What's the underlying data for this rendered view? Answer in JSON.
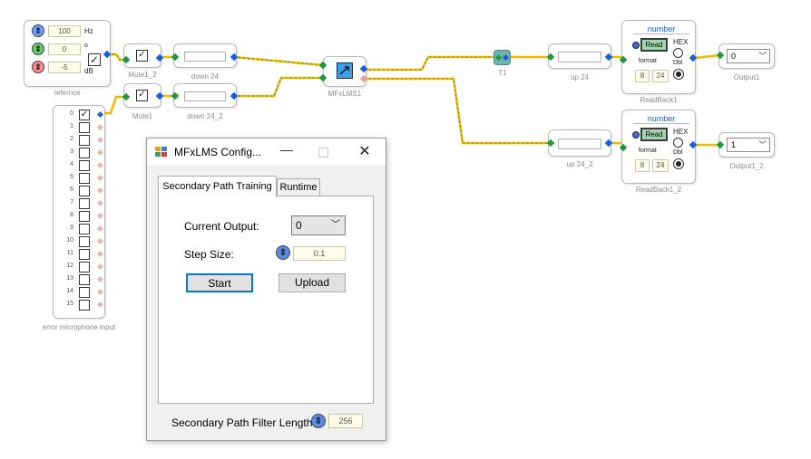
{
  "colors": {
    "wire": "#f5b800",
    "port_blue": "#1460e0",
    "port_green": "#1a9a3a",
    "accent": "#0a64c8"
  },
  "canvas": {
    "reference": {
      "caption": "refernce",
      "freq_value": "100",
      "freq_unit": "Hz",
      "phase_value": "0",
      "phase_unit": "o",
      "gain_value": "-5",
      "gain_unit": "dB"
    },
    "mute1_2": {
      "caption": "Mute1_2"
    },
    "mute1": {
      "caption": "Mute1"
    },
    "down24": {
      "caption": "down 24"
    },
    "down24_2": {
      "caption": "down 24_2"
    },
    "mfxlms": {
      "caption": "MFxLMS1"
    },
    "t1": {
      "caption": "T1"
    },
    "up24": {
      "caption": "up 24"
    },
    "up24_2": {
      "caption": "up 24_2"
    },
    "readback1": {
      "title": "number",
      "read_label": "Read",
      "hex_label": "HEX",
      "format_label": "format",
      "dbl_label": "Dbl",
      "format_a": "8",
      "format_b": "24",
      "caption": "ReadBack1"
    },
    "readback1_2": {
      "title": "number",
      "read_label": "Read",
      "hex_label": "HEX",
      "format_label": "format",
      "dbl_label": "Dbl",
      "format_a": "8",
      "format_b": "24",
      "caption": "ReadBack1_2"
    },
    "output1": {
      "value": "0",
      "caption": "Output1"
    },
    "output1_2": {
      "value": "1",
      "caption": "Output1_2"
    },
    "error_mic": {
      "caption": "error microphone input",
      "channels": [
        "0",
        "1",
        "2",
        "3",
        "4",
        "5",
        "6",
        "7",
        "8",
        "9",
        "10",
        "11",
        "12",
        "13",
        "14",
        "15"
      ]
    }
  },
  "dialog": {
    "title": "MFxLMS Config...",
    "tabs": [
      "Secondary Path Training",
      "Runtime"
    ],
    "current_output_label": "Current Output:",
    "current_output_value": "0",
    "step_size_label": "Step Size:",
    "step_size_value": "0.1",
    "start_label": "Start",
    "upload_label": "Upload",
    "filter_length_label": "Secondary Path Filter Length:",
    "filter_length_value": "256"
  }
}
